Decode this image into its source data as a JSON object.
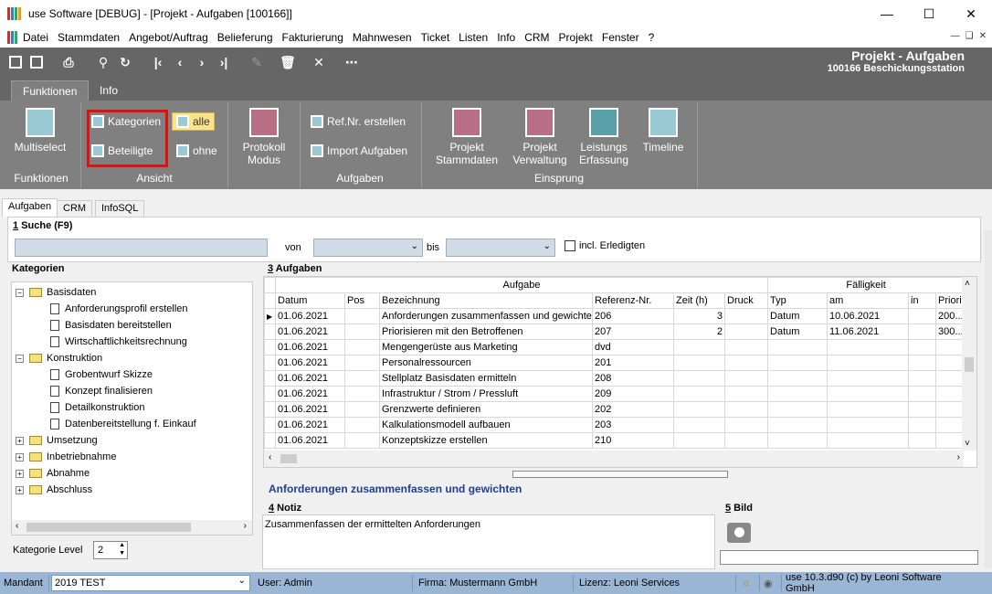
{
  "window": {
    "title": "use Software [DEBUG] - [Projekt - Aufgaben [100166]]"
  },
  "menu": [
    "Datei",
    "Stammdaten",
    "Angebot/Auftrag",
    "Belieferung",
    "Fakturierung",
    "Mahnwesen",
    "Ticket",
    "Listen",
    "Info",
    "CRM",
    "Projekt",
    "Fenster",
    "?"
  ],
  "header": {
    "title": "Projekt - Aufgaben",
    "subtitle": "100166 Beschickungsstation"
  },
  "ribbon_tabs": [
    "Funktionen",
    "Info"
  ],
  "ribbon": {
    "multiselect": "Multiselect",
    "funktionen_group": "Funktionen",
    "kategorien": "Kategorien",
    "beteiligte": "Beteiligte",
    "alle": "alle",
    "ohne": "ohne",
    "ansicht_group": "Ansicht",
    "protokoll_1": "Protokoll",
    "protokoll_2": "Modus",
    "refnr": "Ref.Nr. erstellen",
    "import": "Import Aufgaben",
    "aufgaben_group": "Aufgaben",
    "projekt_stamm_1": "Projekt",
    "projekt_stamm_2": "Stammdaten",
    "projekt_verw_1": "Projekt",
    "projekt_verw_2": "Verwaltung",
    "leistungs_1": "Leistungs",
    "leistungs_2": "Erfassung",
    "timeline": "Timeline",
    "einsprung_group": "Einsprung"
  },
  "subtabs": [
    "Aufgaben",
    "CRM",
    "InfoSQL"
  ],
  "search": {
    "header_num": "1",
    "header_text": " Suche (F9)",
    "von": "von",
    "bis": "bis",
    "erledigt": "incl. Erledigten"
  },
  "kategorien": {
    "header": "Kategorien",
    "tree": [
      {
        "label": "Basisdaten",
        "level": 0,
        "type": "folder",
        "exp": "⊟"
      },
      {
        "label": "Anforderungsprofil erstellen",
        "level": 1,
        "type": "doc"
      },
      {
        "label": "Basisdaten bereitstellen",
        "level": 1,
        "type": "doc"
      },
      {
        "label": "Wirtschaftlichkeitsrechnung",
        "level": 1,
        "type": "doc"
      },
      {
        "label": "Konstruktion",
        "level": 0,
        "type": "folder",
        "exp": "⊟"
      },
      {
        "label": "Grobentwurf Skizze",
        "level": 1,
        "type": "doc"
      },
      {
        "label": "Konzept finalisieren",
        "level": 1,
        "type": "doc"
      },
      {
        "label": "Detailkonstruktion",
        "level": 1,
        "type": "doc"
      },
      {
        "label": "Datenbereitstellung f. Einkauf",
        "level": 1,
        "type": "doc"
      },
      {
        "label": "Umsetzung",
        "level": 0,
        "type": "folder",
        "exp": "⊞"
      },
      {
        "label": "Inbetriebnahme",
        "level": 0,
        "type": "folder",
        "exp": "⊞"
      },
      {
        "label": "Abnahme",
        "level": 0,
        "type": "folder",
        "exp": "⊞"
      },
      {
        "label": "Abschluss",
        "level": 0,
        "type": "folder",
        "exp": "⊞"
      }
    ],
    "level_label": "Kategorie Level",
    "level_value": "2"
  },
  "aufgaben": {
    "header_num": "3",
    "header_text": " Aufgaben",
    "group_aufgabe": "Aufgabe",
    "group_faelligkeit": "Fälligkeit",
    "columns": [
      "Datum",
      "Pos",
      "Bezeichnung",
      "Referenz-Nr.",
      "Zeit (h)",
      "Druck",
      "Typ",
      "am",
      "in",
      "Priori"
    ],
    "rows": [
      [
        "01.06.2021",
        "",
        "Anforderungen zusammenfassen und gewichten",
        "206",
        "3",
        "",
        "Datum",
        "10.06.2021",
        "",
        "200..."
      ],
      [
        "01.06.2021",
        "",
        "Priorisieren mit den Betroffenen",
        "207",
        "2",
        "",
        "Datum",
        "11.06.2021",
        "",
        "300..."
      ],
      [
        "01.06.2021",
        "",
        "Mengengerüste aus Marketing",
        "dvd",
        "",
        "",
        "",
        "",
        "",
        ""
      ],
      [
        "01.06.2021",
        "",
        "Personalressourcen",
        "201",
        "",
        "",
        "",
        "",
        "",
        ""
      ],
      [
        "01.06.2021",
        "",
        "Stellplatz Basisdaten ermitteln",
        "208",
        "",
        "",
        "",
        "",
        "",
        ""
      ],
      [
        "01.06.2021",
        "",
        "Infrastruktur / Strom / Pressluft",
        "209",
        "",
        "",
        "",
        "",
        "",
        ""
      ],
      [
        "01.06.2021",
        "",
        "Grenzwerte definieren",
        "202",
        "",
        "",
        "",
        "",
        "",
        ""
      ],
      [
        "01.06.2021",
        "",
        "Kalkulationsmodell aufbauen",
        "203",
        "",
        "",
        "",
        "",
        "",
        ""
      ],
      [
        "01.06.2021",
        "",
        "Konzeptskizze erstellen",
        "210",
        "",
        "",
        "",
        "",
        "",
        ""
      ]
    ],
    "selected_title": "Anforderungen zusammenfassen und gewichten"
  },
  "notiz": {
    "header_num": "4",
    "header_text": " Notiz",
    "text": "Zusammenfassen der ermittelten Anforderungen"
  },
  "bild": {
    "header_num": "5",
    "header_text": " Bild"
  },
  "status": {
    "mandant_label": "Mandant",
    "mandant_value": "2019 TEST",
    "user": "User: Admin",
    "firma": "Firma: Mustermann GmbH",
    "lizenz": "Lizenz: Leoni Services",
    "version": "use 10.3.d90 (c) by Leoni Software GmbH"
  }
}
